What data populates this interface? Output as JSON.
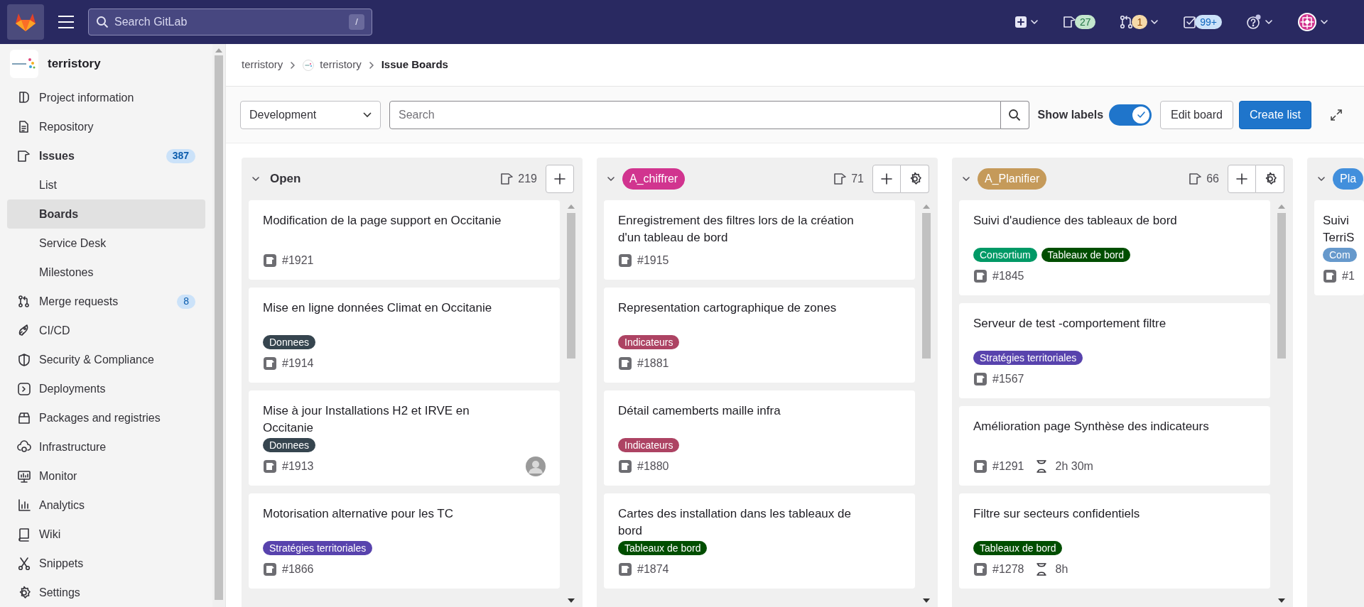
{
  "top_bar": {
    "search": {
      "placeholder": "Search GitLab",
      "shortcut": "/"
    },
    "items": [
      {
        "kind": "create"
      },
      {
        "kind": "issues",
        "count": "27",
        "color": "#c3e6cd"
      },
      {
        "kind": "merge_requests",
        "count": "1",
        "color": "#f5d9a8"
      },
      {
        "kind": "todos",
        "count": "99+",
        "color": "#cbe2f9"
      },
      {
        "kind": "help"
      },
      {
        "kind": "user"
      }
    ]
  },
  "sidebar": {
    "project": "terristory",
    "items": [
      {
        "label": "Project information",
        "selected": false,
        "expanded": false
      },
      {
        "label": "Repository",
        "selected": false,
        "expanded": false
      },
      {
        "label": "Issues",
        "badge": "387",
        "selected": false,
        "expanded": true,
        "children": [
          {
            "label": "List",
            "selected": false
          },
          {
            "label": "Boards",
            "selected": true
          },
          {
            "label": "Service Desk",
            "selected": false
          },
          {
            "label": "Milestones",
            "selected": false
          }
        ]
      },
      {
        "label": "Merge requests",
        "badge": "8",
        "selected": false,
        "expanded": false
      },
      {
        "label": "CI/CD",
        "selected": false,
        "expanded": false
      },
      {
        "label": "Security & Compliance",
        "selected": false,
        "expanded": false
      },
      {
        "label": "Deployments",
        "selected": false,
        "expanded": false
      },
      {
        "label": "Packages and registries",
        "selected": false,
        "expanded": false
      },
      {
        "label": "Infrastructure",
        "selected": false,
        "expanded": false
      },
      {
        "label": "Monitor",
        "selected": false,
        "expanded": false
      },
      {
        "label": "Analytics",
        "selected": false,
        "expanded": false
      },
      {
        "label": "Wiki",
        "selected": false,
        "expanded": false
      },
      {
        "label": "Snippets",
        "selected": false,
        "expanded": false
      },
      {
        "label": "Settings",
        "selected": false,
        "expanded": false
      }
    ]
  },
  "breadcrumb": [
    {
      "kind": "group",
      "text": "terristory"
    },
    {
      "kind": "project",
      "text": "terristory"
    },
    {
      "kind": "current",
      "text": "Issue Boards"
    }
  ],
  "filter_bar": {
    "board": "Development",
    "search": {
      "placeholder": "Search"
    },
    "show_labels": {
      "label": "Show labels",
      "on": true
    },
    "edit_button": "Edit board",
    "create_button": "Create list"
  },
  "lists": [
    {
      "kind": "plain",
      "title": "Open",
      "count": "219",
      "settings": false,
      "cards": [
        {
          "title": "Modification de la page support en Occitanie",
          "number": "#1921",
          "assignee": false
        },
        {
          "title": "Mise en ligne données Climat en Occitanie",
          "labels": [
            {
              "text": "Donnees",
              "color": "#36454f"
            }
          ],
          "number": "#1914",
          "assignee": false
        },
        {
          "title": "Mise à jour Installations H2 et IRVE en Occitanie",
          "labels": [
            {
              "text": "Donnees",
              "color": "#36454f"
            }
          ],
          "number": "#1913",
          "assignee": true
        },
        {
          "title": "Motorisation alternative pour les TC",
          "labels": [
            {
              "text": "Stratégies territoriales",
              "color": "#5843ad"
            }
          ],
          "number": "#1866",
          "assignee": false
        }
      ]
    },
    {
      "kind": "label",
      "title": "A_chiffrer",
      "color": "#d1348f",
      "count": "71",
      "settings": true,
      "cards": [
        {
          "title": "Enregistrement des filtres lors de la création d'un tableau de bord",
          "number": "#1915",
          "assignee": false
        },
        {
          "title": "Representation cartographique de zones",
          "labels": [
            {
              "text": "Indicateurs",
              "color": "#ad4363"
            }
          ],
          "number": "#1881",
          "assignee": false
        },
        {
          "title": "Détail camemberts maille infra",
          "labels": [
            {
              "text": "Indicateurs",
              "color": "#ad4363"
            }
          ],
          "number": "#1880",
          "assignee": false
        },
        {
          "title": "Cartes des installation dans les tableaux de bord",
          "labels": [
            {
              "text": "Tableaux de bord",
              "color": "#004e00"
            }
          ],
          "number": "#1874",
          "assignee": false
        }
      ]
    },
    {
      "kind": "label",
      "title": "A_Planifier",
      "color": "#c59a5a",
      "count": "66",
      "settings": true,
      "cards": [
        {
          "title": "Suivi d'audience des tableaux de bord",
          "labels": [
            {
              "text": "Consortium",
              "color": "#009966"
            },
            {
              "text": "Tableaux de bord",
              "color": "#004e00"
            }
          ],
          "number": "#1845",
          "assignee": false
        },
        {
          "title": "Serveur de test -comportement filtre",
          "labels": [
            {
              "text": "Stratégies territoriales",
              "color": "#5843ad"
            }
          ],
          "number": "#1567",
          "assignee": false
        },
        {
          "title": "Amélioration page Synthèse des indicateurs",
          "number": "#1291",
          "time": "2h 30m",
          "assignee": false
        },
        {
          "title": "Filtre sur secteurs confidentiels",
          "labels": [
            {
              "text": "Tableaux de bord",
              "color": "#004e00"
            }
          ],
          "number": "#1278",
          "time": "8h",
          "assignee": false
        }
      ]
    },
    {
      "kind": "label",
      "title": "Pla",
      "color": "#428fdc",
      "cards": [
        {
          "title": "Suivi TerriS",
          "labels": [
            {
              "text": "Com",
              "color": "#6699cc"
            }
          ],
          "number": "#1"
        }
      ]
    }
  ]
}
